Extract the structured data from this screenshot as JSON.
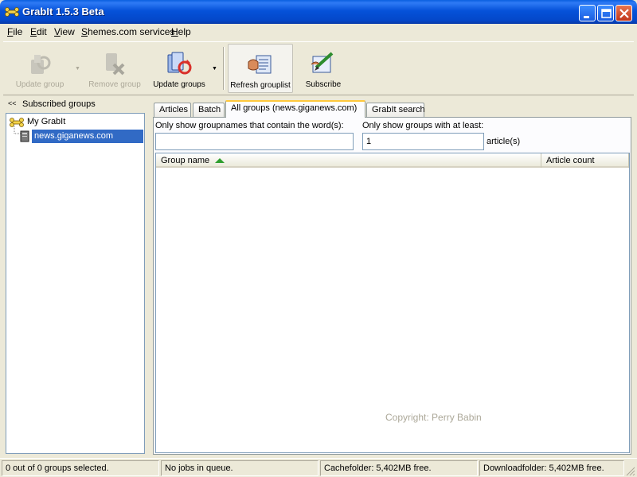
{
  "window": {
    "title": "GrabIt 1.5.3 Beta",
    "controls": {
      "minimize": "minimize",
      "maximize": "maximize",
      "close": "close"
    }
  },
  "menu": [
    {
      "label": "File",
      "mnemonic": "F",
      "rest": "ile"
    },
    {
      "label": "Edit",
      "mnemonic": "E",
      "rest": "dit"
    },
    {
      "label": "View",
      "mnemonic": "V",
      "rest": "iew"
    },
    {
      "label": "Shemes.com services",
      "mnemonic": "S",
      "rest": "hemes.com services"
    },
    {
      "label": "Help",
      "mnemonic": "H",
      "rest": "elp"
    }
  ],
  "toolbar": {
    "update_group": "Update group",
    "remove_group": "Remove group",
    "update_groups": "Update groups",
    "refresh_grouplist": "Refresh grouplist",
    "subscribe": "Subscribe"
  },
  "left_panel": {
    "collapse_glyph": "<<",
    "header": "Subscribed groups",
    "tree": {
      "root": "My GrabIt",
      "server": "news.giganews.com"
    }
  },
  "tabs": [
    {
      "label": "Articles"
    },
    {
      "label": "Batch"
    },
    {
      "label": "All groups (news.giganews.com)"
    },
    {
      "label": "GrabIt search"
    }
  ],
  "filters": {
    "name_label": "Only show groupnames that contain the word(s):",
    "name_value": "",
    "min_label": "Only show groups with at least:",
    "min_value": "1",
    "min_suffix": "article(s)"
  },
  "list": {
    "columns": [
      "Group name",
      "Article count"
    ],
    "sort_indicator": "ascending",
    "rows": []
  },
  "watermark": "Copyright: Perry Babin",
  "status": {
    "selection": "0 out of 0 groups selected.",
    "jobs": "No jobs in queue.",
    "cache": "Cachefolder: 5,402MB free.",
    "download": "Downloadfolder: 5,402MB free."
  },
  "colors": {
    "titlebar": "#0552d9",
    "active_tab_accent": "#ffc83c",
    "selection": "#316ac5",
    "sort_arrow": "#2e9e2e"
  }
}
